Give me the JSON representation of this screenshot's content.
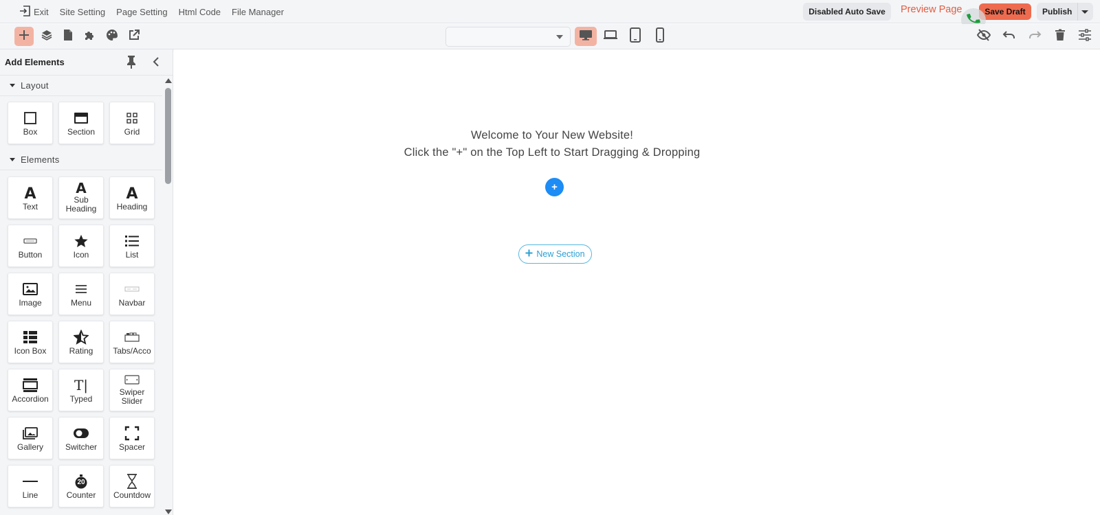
{
  "topbar": {
    "exit_label": "Exit",
    "menu": [
      "Site Setting",
      "Page Setting",
      "Html Code",
      "File Manager"
    ],
    "autosave_label": "Disabled Auto Save",
    "preview_label": "Preview Page",
    "save_draft_label": "Save Draft",
    "publish_label": "Publish"
  },
  "toolbar": {
    "left_tools": [
      "add-icon",
      "layers-icon",
      "page-icon",
      "puzzle-icon",
      "palette-icon",
      "external-link-icon"
    ],
    "device_select_value": "",
    "devices": [
      "desktop-icon",
      "laptop-icon",
      "tablet-icon",
      "mobile-icon"
    ],
    "right_tools": [
      "hide-icon",
      "undo-icon",
      "redo-icon",
      "trash-icon",
      "settings-sliders-icon"
    ]
  },
  "sidebar": {
    "title": "Add Elements",
    "layout_label": "Layout",
    "layout_items": [
      {
        "label": "Box",
        "icon": "box-icon"
      },
      {
        "label": "Section",
        "icon": "section-icon"
      },
      {
        "label": "Grid",
        "icon": "grid-icon"
      }
    ],
    "elements_label": "Elements",
    "element_items": [
      {
        "label": "Text",
        "icon": "text-icon"
      },
      {
        "label": "Sub Heading",
        "icon": "sub-heading-icon"
      },
      {
        "label": "Heading",
        "icon": "heading-icon"
      },
      {
        "label": "Button",
        "icon": "button-icon"
      },
      {
        "label": "Icon",
        "icon": "star-icon"
      },
      {
        "label": "List",
        "icon": "list-icon"
      },
      {
        "label": "Image",
        "icon": "image-icon"
      },
      {
        "label": "Menu",
        "icon": "menu-icon"
      },
      {
        "label": "Navbar",
        "icon": "navbar-icon"
      },
      {
        "label": "Icon Box",
        "icon": "icon-box-icon"
      },
      {
        "label": "Rating",
        "icon": "rating-icon"
      },
      {
        "label": "Tabs/Acco",
        "icon": "tabs-icon"
      },
      {
        "label": "Accordion",
        "icon": "accordion-icon"
      },
      {
        "label": "Typed",
        "icon": "typed-icon"
      },
      {
        "label": "Swiper Slider",
        "icon": "slider-icon"
      },
      {
        "label": "Gallery",
        "icon": "gallery-icon"
      },
      {
        "label": "Switcher",
        "icon": "switcher-icon"
      },
      {
        "label": "Spacer",
        "icon": "spacer-icon"
      },
      {
        "label": "Line",
        "icon": "line-icon"
      },
      {
        "label": "Counter",
        "icon": "counter-icon"
      },
      {
        "label": "Countdow",
        "icon": "countdown-icon"
      }
    ],
    "counter_icon_text": "20",
    "typed_icon_text": "T|"
  },
  "canvas": {
    "welcome_line1": "Welcome to Your New Website!",
    "welcome_line2": "Click the \"+\" on the Top Left to Start Dragging & Dropping",
    "plus_label": "+",
    "new_section_label": "New Section"
  }
}
